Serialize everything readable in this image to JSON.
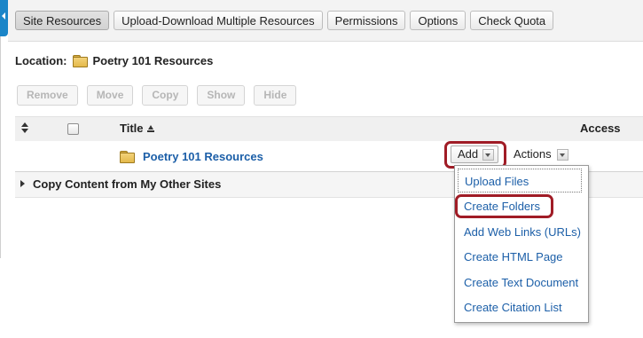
{
  "tabs": [
    {
      "label": "Site Resources",
      "active": true
    },
    {
      "label": "Upload-Download Multiple Resources",
      "active": false
    },
    {
      "label": "Permissions",
      "active": false
    },
    {
      "label": "Options",
      "active": false
    },
    {
      "label": "Check Quota",
      "active": false
    }
  ],
  "location": {
    "label": "Location:",
    "folder_name": "Poetry 101 Resources"
  },
  "actions": {
    "remove": "Remove",
    "move": "Move",
    "copy": "Copy",
    "show": "Show",
    "hide": "Hide"
  },
  "table": {
    "title_header": "Title",
    "access_header": "Access"
  },
  "folder_row": {
    "name": "Poetry 101 Resources",
    "add_label": "Add",
    "actions_label": "Actions"
  },
  "copy_row": {
    "label": "Copy Content from My Other Sites"
  },
  "add_menu": {
    "items": [
      "Upload Files",
      "Create Folders",
      "Add Web Links (URLs)",
      "Create HTML Page",
      "Create Text Document",
      "Create Citation List"
    ]
  },
  "colors": {
    "link": "#1c5fa8",
    "highlight": "#a01c26",
    "side_tab": "#1a85c8",
    "folder": "#e4b94b"
  }
}
